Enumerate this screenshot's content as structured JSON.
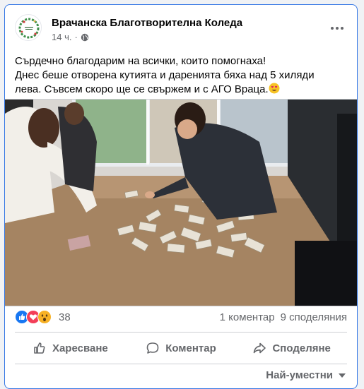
{
  "post": {
    "page_name": "Врачанска Благотворителна Коледа",
    "time": "14 ч.",
    "privacy_icon": "globe-icon",
    "text_lines": [
      "Сърдечно благодарим на всички, които помогнаха!",
      "Днес беше отворена кутията и даренията бяха над 5 хиляди",
      "лева. Съвсем скоро ще се свържем и с АГО Враца."
    ],
    "emoji": "heart-eyes-emoji"
  },
  "stats": {
    "reaction_icons": [
      "like-icon",
      "love-icon",
      "wow-icon"
    ],
    "reaction_count": "38",
    "comments": "1 коментар",
    "shares": "9 споделяния"
  },
  "actions": {
    "like_label": "Харесване",
    "comment_label": "Коментар",
    "share_label": "Споделяне"
  },
  "sort": {
    "label": "Най-уместни"
  },
  "colors": {
    "accent": "#3578e5",
    "like": "#1877f2",
    "love": "#f33e58",
    "wow": "#f7b125",
    "secondary_text": "#65676b"
  }
}
